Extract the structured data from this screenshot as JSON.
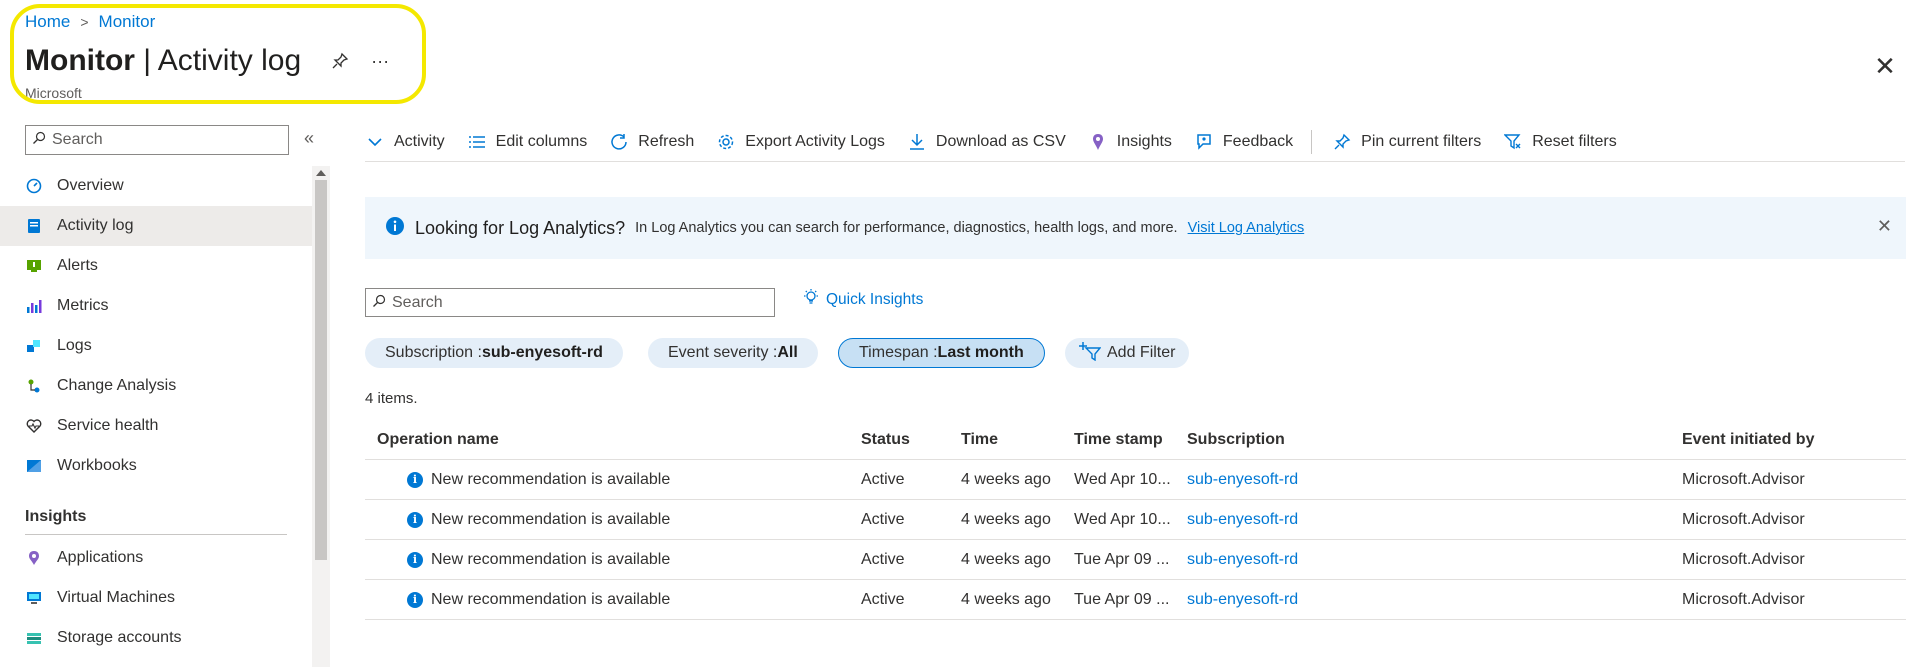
{
  "breadcrumb": {
    "home": "Home",
    "separator": ">",
    "current": "Monitor"
  },
  "header": {
    "title_bold": "Monitor",
    "title_rest": " | Activity log",
    "subtitle": "Microsoft",
    "pin_icon": "pin-icon",
    "more_label": "···",
    "close_label": "✕"
  },
  "sidebar": {
    "search_placeholder": "Search",
    "collapse_label": "«",
    "items": [
      {
        "label": "Overview",
        "icon": "overview-icon"
      },
      {
        "label": "Activity log",
        "icon": "activity-log-icon",
        "active": true
      },
      {
        "label": "Alerts",
        "icon": "alerts-icon"
      },
      {
        "label": "Metrics",
        "icon": "metrics-icon"
      },
      {
        "label": "Logs",
        "icon": "logs-icon"
      },
      {
        "label": "Change Analysis",
        "icon": "change-analysis-icon"
      },
      {
        "label": "Service health",
        "icon": "service-health-icon"
      },
      {
        "label": "Workbooks",
        "icon": "workbooks-icon"
      }
    ],
    "section_insights": "Insights",
    "insights_items": [
      {
        "label": "Applications",
        "icon": "applications-icon"
      },
      {
        "label": "Virtual Machines",
        "icon": "virtual-machines-icon"
      },
      {
        "label": "Storage accounts",
        "icon": "storage-accounts-icon"
      }
    ]
  },
  "toolbar": {
    "activity": "Activity",
    "edit_columns": "Edit columns",
    "refresh": "Refresh",
    "export": "Export Activity Logs",
    "download_csv": "Download as CSV",
    "insights": "Insights",
    "feedback": "Feedback",
    "pin_filters": "Pin current filters",
    "reset_filters": "Reset filters"
  },
  "banner": {
    "title": "Looking for Log Analytics?",
    "text": "In Log Analytics you can search for performance, diagnostics, health logs, and more.",
    "link": "Visit Log Analytics",
    "close": "✕"
  },
  "search": {
    "placeholder": "Search",
    "quick_insights": "Quick Insights"
  },
  "filters": {
    "subscription_label": "Subscription : ",
    "subscription_value": "sub-enyesoft-rd",
    "severity_label": "Event severity : ",
    "severity_value": "All",
    "timespan_label": "Timespan : ",
    "timespan_value": "Last month",
    "add_filter": "Add Filter"
  },
  "items_count": "4 items.",
  "table": {
    "columns": [
      "Operation name",
      "Status",
      "Time",
      "Time stamp",
      "Subscription",
      "Event initiated by"
    ],
    "rows": [
      {
        "operation": "New recommendation is available",
        "status": "Active",
        "time": "4 weeks ago",
        "timestamp": "Wed Apr 10...",
        "subscription": "sub-enyesoft-rd",
        "initiated_by": "Microsoft.Advisor"
      },
      {
        "operation": "New recommendation is available",
        "status": "Active",
        "time": "4 weeks ago",
        "timestamp": "Wed Apr 10...",
        "subscription": "sub-enyesoft-rd",
        "initiated_by": "Microsoft.Advisor"
      },
      {
        "operation": "New recommendation is available",
        "status": "Active",
        "time": "4 weeks ago",
        "timestamp": "Tue Apr 09 ...",
        "subscription": "sub-enyesoft-rd",
        "initiated_by": "Microsoft.Advisor"
      },
      {
        "operation": "New recommendation is available",
        "status": "Active",
        "time": "4 weeks ago",
        "timestamp": "Tue Apr 09 ...",
        "subscription": "sub-enyesoft-rd",
        "initiated_by": "Microsoft.Advisor"
      }
    ]
  },
  "colors": {
    "accent": "#0078d4",
    "highlight": "#f4e800",
    "banner_bg": "#eff6fc",
    "pill_bg": "#e4eef8",
    "active_nav": "#edebe9"
  }
}
